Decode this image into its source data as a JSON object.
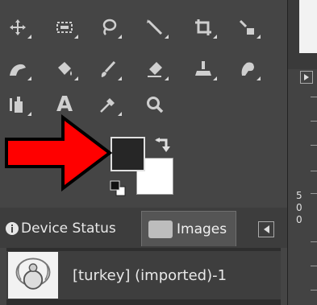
{
  "toolbox": {
    "tools": [
      {
        "icon": "move-icon"
      },
      {
        "icon": "rect-select-icon"
      },
      {
        "icon": "free-select-icon"
      },
      {
        "icon": "fuzzy-select-icon"
      },
      {
        "icon": "crop-icon"
      },
      {
        "icon": "unified-transform-icon"
      },
      {
        "icon": "warp-transform-icon"
      },
      {
        "icon": "bucket-fill-icon"
      },
      {
        "icon": "paintbrush-icon"
      },
      {
        "icon": "eraser-icon"
      },
      {
        "icon": "clone-icon"
      },
      {
        "icon": "smudge-icon"
      },
      {
        "icon": "paths-icon"
      },
      {
        "icon": "text-icon"
      },
      {
        "icon": "color-picker-icon"
      },
      {
        "icon": "zoom-icon"
      }
    ],
    "text_tool_glyph": "A",
    "colors": {
      "foreground": "#262626",
      "background": "#ffffff",
      "annotation_arrow": "#ff0000"
    }
  },
  "dock": {
    "tabs": [
      {
        "label": "Device Status",
        "icon": "device-status-icon"
      },
      {
        "label": "Images",
        "icon": "images-thumb-icon"
      }
    ],
    "images": [
      {
        "label": "[turkey] (imported)-1"
      }
    ]
  },
  "ruler": {
    "digits": [
      "5",
      "0",
      "0"
    ]
  }
}
